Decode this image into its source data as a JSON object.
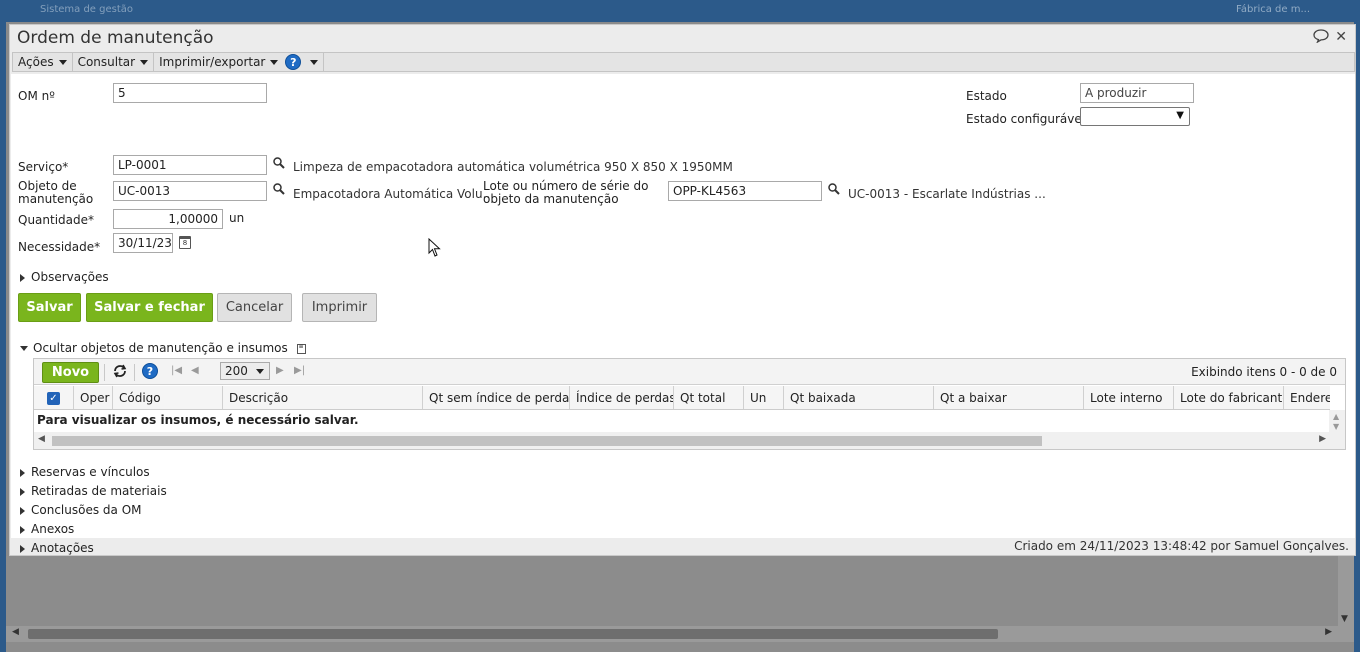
{
  "background": {
    "app_title": "Sistema de gestão",
    "right_text": "Fábrica de m..."
  },
  "window": {
    "title": "Ordem de manutenção"
  },
  "menubar": {
    "actions": "Ações",
    "consult": "Consultar",
    "print_export": "Imprimir/exportar",
    "help": "?"
  },
  "form": {
    "om_label": "OM nº",
    "om_value": "5",
    "status_label": "Estado",
    "status_value": "A produzir",
    "config_status_label": "Estado configurável",
    "config_status_value": "",
    "service_label": "Serviço*",
    "service_value": "LP-0001",
    "service_desc": "Limpeza de empacotadora automática volumétrica 950 X 850 X 1950MM",
    "object_label_1": "Objeto de",
    "object_label_2": "manutenção",
    "object_value": "UC-0013",
    "object_desc": "Empacotadora Automática Volu...",
    "lot_label_1": "Lote ou número de série do",
    "lot_label_2": "objeto da manutenção",
    "lot_value": "OPP-KL4563",
    "lot_desc": "UC-0013 - Escarlate Indústrias ...",
    "qty_label": "Quantidade*",
    "qty_value": "1,00000",
    "qty_unit": "un",
    "need_label": "Necessidade*",
    "need_value": "30/11/23",
    "observations": "Observações"
  },
  "buttons": {
    "save": "Salvar",
    "save_close": "Salvar e fechar",
    "cancel": "Cancelar",
    "print": "Imprimir"
  },
  "inputs_section": {
    "title": "Ocultar objetos de manutenção e insumos",
    "new_button": "Novo",
    "page_size": "200",
    "showing": "Exibindo itens 0 - 0 de 0",
    "columns": [
      "Oper",
      "Código",
      "Descrição",
      "Qt sem índice de perdas",
      "Índice de perdas",
      "Qt total",
      "Un",
      "Qt baixada",
      "Qt a baixar",
      "Lote interno",
      "Lote do fabricante",
      "Endere"
    ],
    "empty_message": "Para visualizar os insumos, é necessário salvar."
  },
  "sections": [
    "Reservas e vínculos",
    "Retiradas de materiais",
    "Conclusões da OM",
    "Anexos",
    "Anotações"
  ],
  "footer": "Criado em 24/11/2023 13:48:42 por Samuel Gonçalves."
}
